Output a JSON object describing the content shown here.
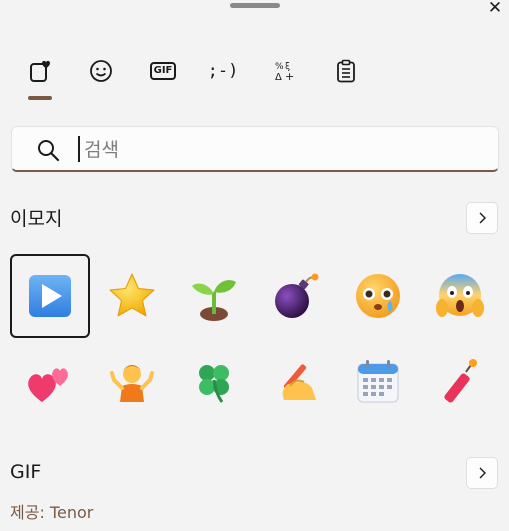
{
  "tabs": [
    {
      "name": "emoji-tab-icon"
    },
    {
      "name": "smiley-tab-icon"
    },
    {
      "name": "gif-tab-icon",
      "label": "GIF"
    },
    {
      "name": "kaomoji-tab-icon",
      "label": ";-)"
    },
    {
      "name": "symbols-tab-icon"
    },
    {
      "name": "clipboard-tab-icon"
    }
  ],
  "search": {
    "placeholder": "검색",
    "value": ""
  },
  "emoji_section": {
    "title": "이모지"
  },
  "gif_section": {
    "title": "GIF",
    "provider": "제공: Tenor"
  },
  "emojis": [
    {
      "name": "play-button-emoji",
      "selected": true
    },
    {
      "name": "star-emoji"
    },
    {
      "name": "seedling-emoji"
    },
    {
      "name": "bomb-emoji"
    },
    {
      "name": "face-holding-back-tears-emoji"
    },
    {
      "name": "face-screaming-in-fear-emoji"
    },
    {
      "name": "two-hearts-emoji"
    },
    {
      "name": "person-shrugging-emoji"
    },
    {
      "name": "four-leaf-clover-emoji"
    },
    {
      "name": "writing-hand-emoji"
    },
    {
      "name": "calendar-emoji"
    },
    {
      "name": "firecracker-emoji"
    }
  ],
  "colors": {
    "accent": "#7a5a45",
    "background": "#f3f3f3"
  }
}
